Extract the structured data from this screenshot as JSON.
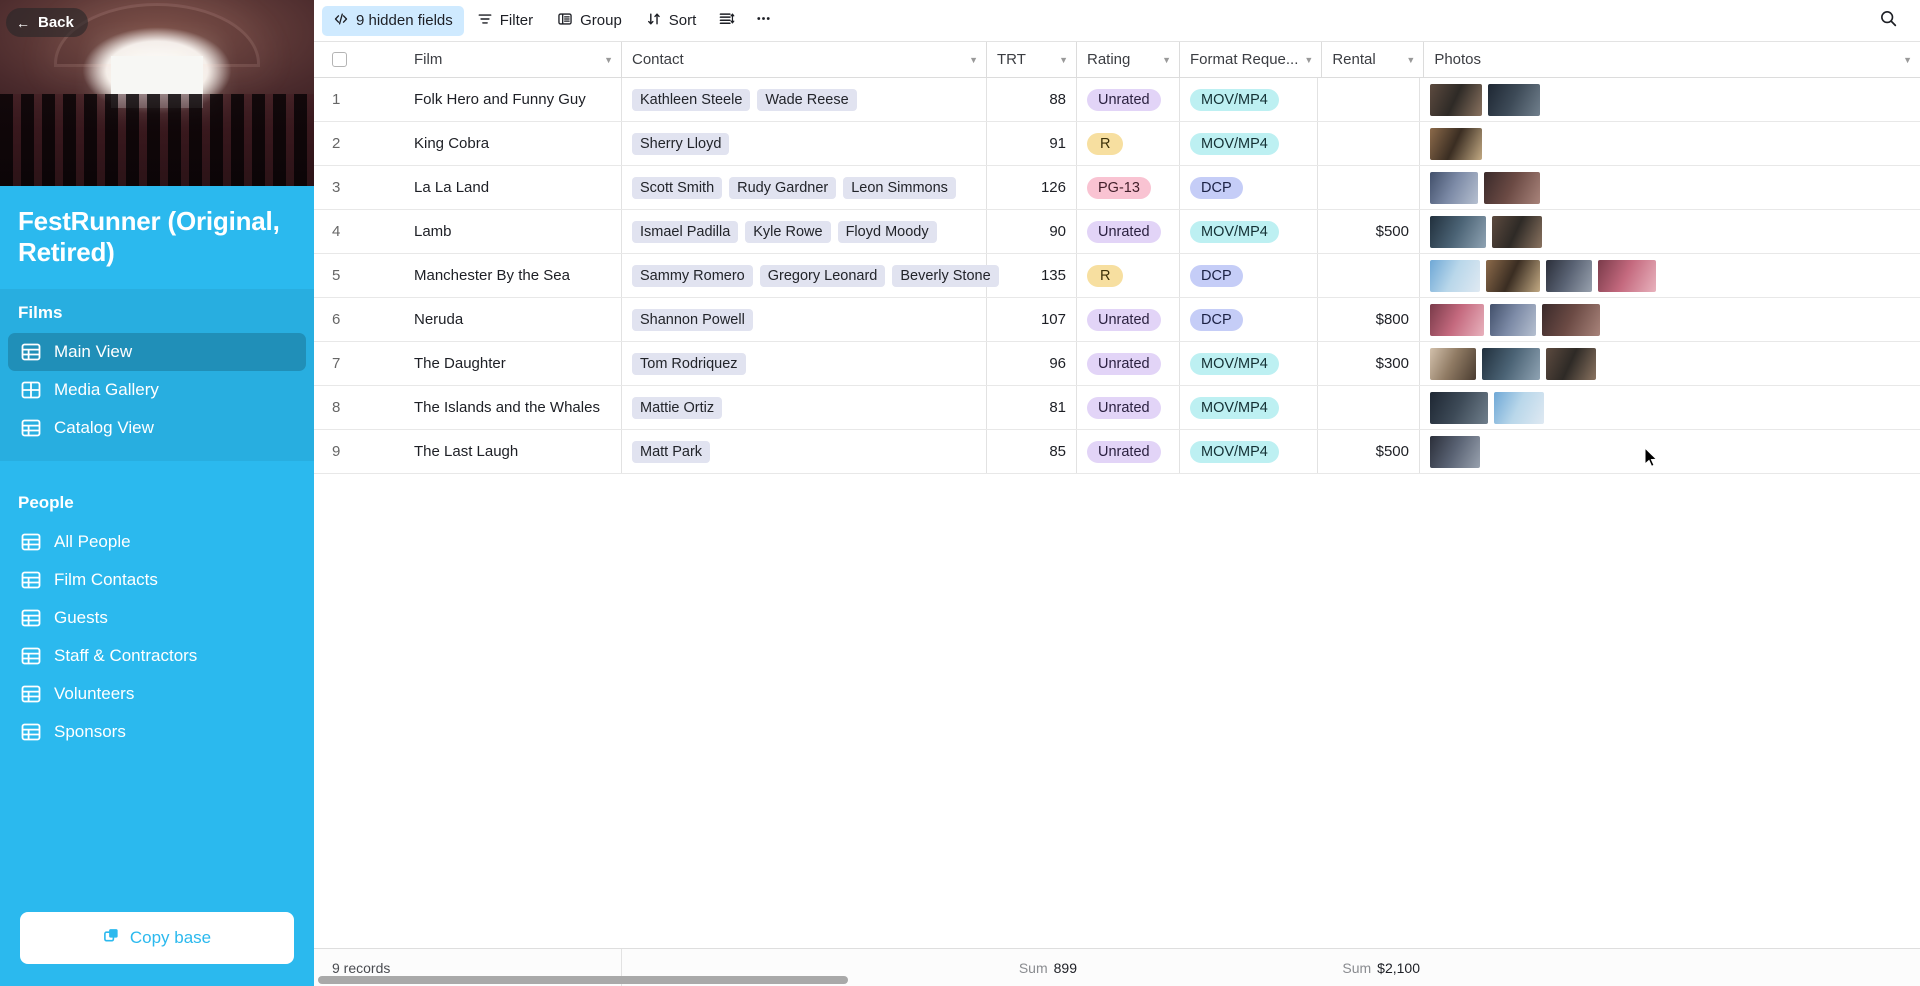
{
  "sidebar": {
    "back_label": "Back",
    "back_icon": "arrow-left-icon",
    "base_title": "FestRunner (Original, Retired)",
    "groups": [
      {
        "label": "Films",
        "items": [
          {
            "label": "Main View",
            "icon": "table-icon",
            "active": true
          },
          {
            "label": "Media Gallery",
            "icon": "gallery-grid-icon",
            "active": false
          },
          {
            "label": "Catalog View",
            "icon": "table-icon",
            "active": false
          }
        ]
      },
      {
        "label": "People",
        "items": [
          {
            "label": "All People",
            "icon": "table-icon",
            "active": false
          },
          {
            "label": "Film Contacts",
            "icon": "table-icon",
            "active": false
          },
          {
            "label": "Guests",
            "icon": "table-icon",
            "active": false
          },
          {
            "label": "Staff & Contractors",
            "icon": "table-icon",
            "active": false
          },
          {
            "label": "Volunteers",
            "icon": "table-icon",
            "active": false
          },
          {
            "label": "Sponsors",
            "icon": "table-icon",
            "active": false
          }
        ]
      }
    ],
    "copy_base_label": "Copy base",
    "copy_base_icon": "copy-icon",
    "accent_color": "#2bb9ee",
    "active_item_color": "#1d86b3"
  },
  "toolbar": {
    "hidden_fields_label": "9 hidden fields",
    "hidden_fields_icon": "hidden-fields-icon",
    "hidden_fields_highlight_color": "#cfeaff",
    "filter_label": "Filter",
    "filter_icon": "filter-icon",
    "group_label": "Group",
    "group_icon": "group-icon",
    "sort_label": "Sort",
    "sort_icon": "sort-icon",
    "row_height_icon": "row-height-icon",
    "more_icon": "ellipsis-icon",
    "search_icon": "search-icon"
  },
  "table": {
    "columns": [
      {
        "key": "num",
        "label": ""
      },
      {
        "key": "film",
        "label": "Film"
      },
      {
        "key": "contact",
        "label": "Contact"
      },
      {
        "key": "trt",
        "label": "TRT"
      },
      {
        "key": "rating",
        "label": "Rating"
      },
      {
        "key": "format",
        "label": "Format Reque..."
      },
      {
        "key": "rental",
        "label": "Rental"
      },
      {
        "key": "photos",
        "label": "Photos"
      }
    ],
    "rows": [
      {
        "num": "1",
        "film": "Folk Hero and Funny Guy",
        "contacts": [
          "Kathleen Steele",
          "Wade Reese"
        ],
        "trt": "88",
        "rating": "Unrated",
        "rating_style": "unrated",
        "format": "MOV/MP4",
        "format_style": "mov",
        "rental": "",
        "photos": 2
      },
      {
        "num": "2",
        "film": "King Cobra",
        "contacts": [
          "Sherry Lloyd"
        ],
        "trt": "91",
        "rating": "R",
        "rating_style": "r",
        "format": "MOV/MP4",
        "format_style": "mov",
        "rental": "",
        "photos": 1
      },
      {
        "num": "3",
        "film": "La La Land",
        "contacts": [
          "Scott Smith",
          "Rudy Gardner",
          "Leon Simmons"
        ],
        "trt": "126",
        "rating": "PG-13",
        "rating_style": "pg13",
        "format": "DCP",
        "format_style": "dcp",
        "rental": "",
        "photos": 2
      },
      {
        "num": "4",
        "film": "Lamb",
        "contacts": [
          "Ismael Padilla",
          "Kyle Rowe",
          "Floyd Moody"
        ],
        "trt": "90",
        "rating": "Unrated",
        "rating_style": "unrated",
        "format": "MOV/MP4",
        "format_style": "mov",
        "rental": "$500",
        "photos": 2
      },
      {
        "num": "5",
        "film": "Manchester By the Sea",
        "contacts": [
          "Sammy Romero",
          "Gregory Leonard",
          "Beverly Stone"
        ],
        "trt": "135",
        "rating": "R",
        "rating_style": "r",
        "format": "DCP",
        "format_style": "dcp",
        "rental": "",
        "photos": 4
      },
      {
        "num": "6",
        "film": "Neruda",
        "contacts": [
          "Shannon Powell"
        ],
        "trt": "107",
        "rating": "Unrated",
        "rating_style": "unrated",
        "format": "DCP",
        "format_style": "dcp",
        "rental": "$800",
        "photos": 3
      },
      {
        "num": "7",
        "film": "The Daughter",
        "contacts": [
          "Tom Rodriquez"
        ],
        "trt": "96",
        "rating": "Unrated",
        "rating_style": "unrated",
        "format": "MOV/MP4",
        "format_style": "mov",
        "rental": "$300",
        "photos": 3
      },
      {
        "num": "8",
        "film": "The Islands and the Whales",
        "contacts": [
          "Mattie Ortiz"
        ],
        "trt": "81",
        "rating": "Unrated",
        "rating_style": "unrated",
        "format": "MOV/MP4",
        "format_style": "mov",
        "rental": "",
        "photos": 2
      },
      {
        "num": "9",
        "film": "The Last Laugh",
        "contacts": [
          "Matt Park"
        ],
        "trt": "85",
        "rating": "Unrated",
        "rating_style": "unrated",
        "format": "MOV/MP4",
        "format_style": "mov",
        "rental": "$500",
        "photos": 1
      }
    ]
  },
  "footer": {
    "record_count": "9 records",
    "trt_sum_label": "Sum",
    "trt_sum_value": "899",
    "rental_sum_label": "Sum",
    "rental_sum_value": "$2,100"
  }
}
